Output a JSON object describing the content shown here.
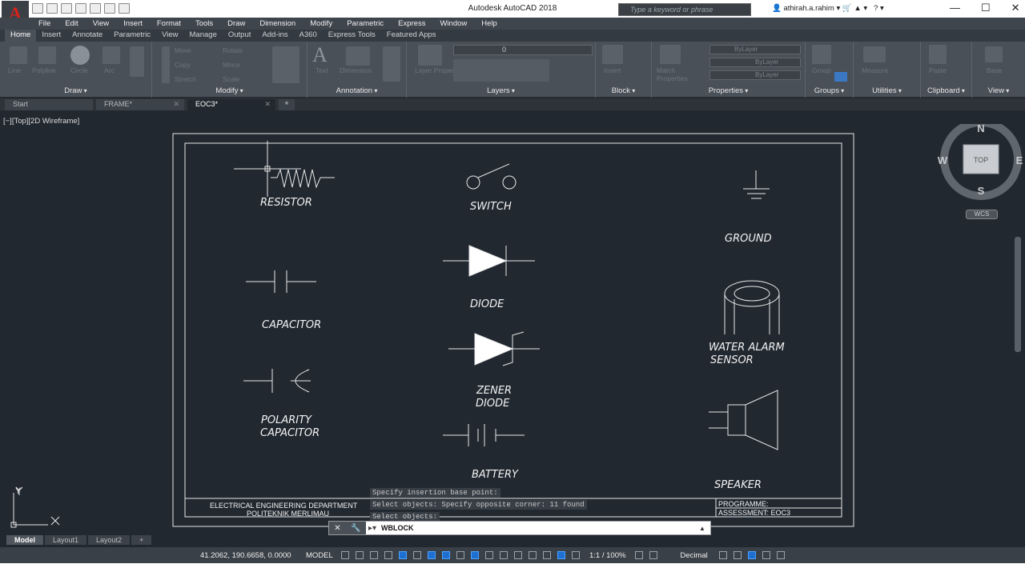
{
  "title": "Autodesk AutoCAD 2018",
  "search_placeholder": "Type a keyword or phrase",
  "user": "athirah.a.rahim",
  "menu": [
    "File",
    "Edit",
    "View",
    "Insert",
    "Format",
    "Tools",
    "Draw",
    "Dimension",
    "Modify",
    "Parametric",
    "Express",
    "Window",
    "Help"
  ],
  "ribbon_tabs": [
    "Home",
    "Insert",
    "Annotate",
    "Parametric",
    "View",
    "Manage",
    "Output",
    "Add-ins",
    "A360",
    "Express Tools",
    "Featured Apps"
  ],
  "panels": {
    "draw": "Draw",
    "modify": "Modify",
    "annotation": "Annotation",
    "layers": "Layers",
    "block": "Block",
    "properties": "Properties",
    "groups": "Groups",
    "utilities": "Utilities",
    "clipboard": "Clipboard",
    "view": "View"
  },
  "ribbon_ghost": {
    "line": "Line",
    "polyline": "Polyline",
    "circle": "Circle",
    "arc": "Arc",
    "move": "Move",
    "rotate": "Rotate",
    "copy": "Copy",
    "mirror": "Mirror",
    "stretch": "Stretch",
    "scale": "Scale",
    "text": "Text",
    "dimension": "Dimension",
    "layer_properties": "Layer Properties",
    "insert": "Insert",
    "match_properties": "Match Properties",
    "bylayer1": "ByLayer",
    "bylayer2": "ByLayer",
    "bylayer3": "ByLayer",
    "group": "Group",
    "measure": "Measure",
    "paste": "Paste",
    "base": "Base",
    "layer_zero": "0"
  },
  "file_tabs": [
    {
      "label": "Start"
    },
    {
      "label": "FRAME*"
    },
    {
      "label": "EOC3*"
    }
  ],
  "viewport_label": "[−][Top][2D Wireframe]",
  "drawing": {
    "resistor": "RESISTOR",
    "switch": "SWITCH",
    "ground": "GROUND",
    "capacitor": "CAPACITOR",
    "diode": "DIODE",
    "water_alarm_1": "WATER ALARM",
    "water_alarm_2": "SENSOR",
    "zener_1": "ZENER",
    "zener_2": "DIODE",
    "polarity_1": "POLARITY",
    "polarity_2": "CAPACITOR",
    "battery": "BATTERY",
    "speaker": "SPEAKER",
    "titleblock_dept": "ELECTRICAL ENGINEERING DEPARTMENT",
    "titleblock_school": "POLITEKNIK MERLIMAU",
    "programme": "PROGRAMME:",
    "assessment": "ASSESSMENT: EOC3"
  },
  "viewcube": {
    "n": "N",
    "s": "S",
    "e": "E",
    "w": "W",
    "face": "TOP",
    "wcs": "WCS"
  },
  "ucs": {
    "x": "X",
    "y": "Y"
  },
  "command_history": [
    "Specify insertion base point:",
    "Select objects: Specify opposite corner: 11 found",
    "Select objects:"
  ],
  "command_input": "WBLOCK",
  "layout_tabs": [
    "Model",
    "Layout1",
    "Layout2"
  ],
  "status": {
    "coords": "41.2062, 190.6658, 0.0000",
    "model": "MODEL",
    "scale": "1:1 / 100%",
    "units": "Decimal"
  }
}
